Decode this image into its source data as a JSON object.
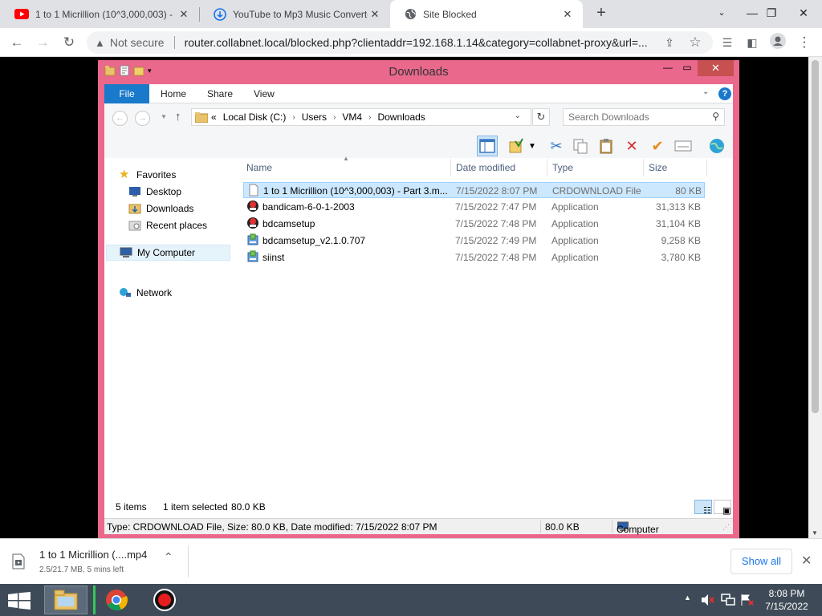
{
  "browser": {
    "tabs": [
      {
        "title": "1 to 1 Micrillion (10^3,000,003) -",
        "icon": "youtube-icon",
        "active": false
      },
      {
        "title": "YouTube to Mp3 Music Converter",
        "icon": "download-cloud-icon",
        "active": false
      },
      {
        "title": "Site Blocked",
        "icon": "globe-icon",
        "active": true
      }
    ],
    "security_label": "Not secure",
    "url": "router.collabnet.local/blocked.php?clientaddr=192.168.1.14&category=collabnet-proxy&url=..."
  },
  "explorer": {
    "title": "Downloads",
    "ribbon_tabs": {
      "file": "File",
      "home": "Home",
      "share": "Share",
      "view": "View"
    },
    "breadcrumb": {
      "overflow": "«",
      "parts": [
        "Local Disk (C:)",
        "Users",
        "VM4",
        "Downloads"
      ]
    },
    "search_placeholder": "Search Downloads",
    "nav": {
      "favorites": "Favorites",
      "desktop": "Desktop",
      "downloads": "Downloads",
      "recent": "Recent places",
      "computer": "My Computer",
      "network": "Network"
    },
    "columns": {
      "name": "Name",
      "date": "Date modified",
      "type": "Type",
      "size": "Size"
    },
    "files": [
      {
        "name": "1 to 1 Micrillion (10^3,000,003) - Part 3.m...",
        "date": "7/15/2022 8:07 PM",
        "type": "CRDOWNLOAD File",
        "size": "80 KB",
        "icon": "blank-file-icon",
        "selected": true
      },
      {
        "name": "bandicam-6-0-1-2003",
        "date": "7/15/2022 7:47 PM",
        "type": "Application",
        "size": "31,313 KB",
        "icon": "bandicam-icon",
        "selected": false
      },
      {
        "name": "bdcamsetup",
        "date": "7/15/2022 7:48 PM",
        "type": "Application",
        "size": "31,104 KB",
        "icon": "bandicam-icon",
        "selected": false
      },
      {
        "name": "bdcamsetup_v2.1.0.707",
        "date": "7/15/2022 7:49 PM",
        "type": "Application",
        "size": "9,258 KB",
        "icon": "installer-icon",
        "selected": false
      },
      {
        "name": "siinst",
        "date": "7/15/2022 7:48 PM",
        "type": "Application",
        "size": "3,780 KB",
        "icon": "installer-icon",
        "selected": false
      }
    ],
    "status": {
      "items": "5 items",
      "selected": "1 item selected",
      "selected_size": "80.0 KB"
    },
    "details_bar": {
      "text": "Type: CRDOWNLOAD File, Size: 80.0 KB, Date modified: 7/15/2022 8:07 PM",
      "size": "80.0 KB",
      "location": "Computer"
    }
  },
  "download_shelf": {
    "name": "1 to 1 Micrillion (....mp4",
    "status": "2.5/21.7 MB, 5 mins left",
    "show_all": "Show all"
  },
  "taskbar": {
    "time": "8:08 PM",
    "date": "7/15/2022"
  },
  "colors": {
    "explorer_frame": "#e9688c",
    "ribbon_file": "#1979ca",
    "selection": "#cce8ff",
    "taskbar": "#3e4a57",
    "chrome_tabstrip": "#dfe1e5"
  }
}
